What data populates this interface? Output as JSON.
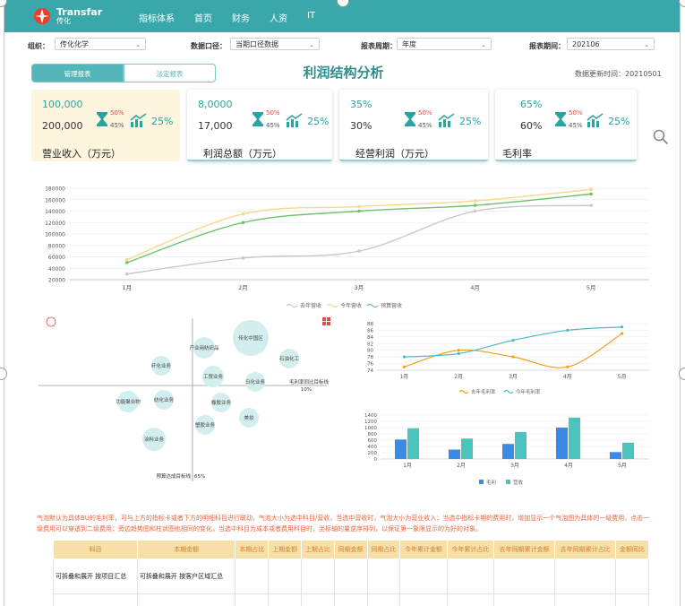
{
  "topbar": {
    "brand": "Transfar",
    "brand_cn": "传化",
    "nav": [
      "指标体系",
      "首页",
      "财务",
      "人资",
      "IT"
    ]
  },
  "filters": [
    {
      "label": "组织：",
      "value": "传化化学"
    },
    {
      "label": "数据口径：",
      "value": "当期口径数据"
    },
    {
      "label": "报表周期：",
      "value": "年度"
    },
    {
      "label": "报表期间：",
      "value": "202106"
    }
  ],
  "tabs": {
    "active": "管理报表",
    "inactive": "法定报表"
  },
  "page_title": "利润结构分析",
  "update_time": "数据更新时间：20210501",
  "cards": [
    {
      "v1": "100,000",
      "v2": "200,000",
      "pct1": "50%",
      "pct2": "45%",
      "pct3": "25%",
      "name": "营业收入（万元）"
    },
    {
      "v1": "8,0000",
      "v2": "17,000",
      "pct1": "50%",
      "pct2": "45%",
      "pct3": "25%",
      "name": "利润总额（万元）"
    },
    {
      "v1": "35%",
      "v2": "30%",
      "pct1": "50%",
      "pct2": "45%",
      "pct3": "25%",
      "name": "经营利润（万元）"
    },
    {
      "v1": "65%",
      "v2": "60%",
      "pct1": "50%",
      "pct2": "45%",
      "pct3": "25%",
      "name": "毛利率"
    }
  ],
  "colors": {
    "teal": "#3aa8aa",
    "yellow": "#f5d98c",
    "green": "#6cc36a",
    "grey": "#c8c8c8",
    "orange": "#f0a020",
    "cyan": "#4fb8c6",
    "bar_blue": "#3b8be6",
    "bar_teal": "#4cc3bd"
  },
  "chart_data": [
    {
      "type": "line",
      "categories": [
        "1月",
        "2月",
        "3月",
        "4月",
        "5月"
      ],
      "ylim": [
        20000,
        180000
      ],
      "yticks": [
        20000,
        40000,
        60000,
        80000,
        100000,
        120000,
        140000,
        160000,
        180000
      ],
      "series": [
        {
          "name": "去年营收",
          "values": [
            30000,
            58000,
            70000,
            140000,
            150000
          ]
        },
        {
          "name": "今年营收",
          "values": [
            55000,
            135000,
            148000,
            158000,
            178000
          ]
        },
        {
          "name": "预算营收",
          "values": [
            50000,
            120000,
            140000,
            150000,
            170000
          ]
        }
      ]
    },
    {
      "type": "scatter",
      "bubbles": [
        "传化中国区",
        "产业用纺织品",
        "石油化工",
        "纤化业务",
        "工贸业务",
        "日化业务",
        "功能聚合物",
        "纺化业务",
        "橡胶业务",
        "塑胶业务",
        "美妆",
        "涂料业务"
      ],
      "xlabel": "毛利率同比目标线",
      "xlabel_value": "10%",
      "ylabel": "预算达成目标线",
      "ylabel_value": "65%"
    },
    {
      "type": "line",
      "categories": [
        "1月",
        "2月",
        "3月",
        "4月",
        "5月"
      ],
      "ylim": [
        74,
        88
      ],
      "yticks": [
        74,
        76,
        78,
        80,
        82,
        84,
        86,
        88
      ],
      "series": [
        {
          "name": "去年毛利率",
          "values": [
            75,
            80,
            78,
            75,
            85
          ]
        },
        {
          "name": "今年毛利率",
          "values": [
            78,
            79,
            83,
            86,
            87
          ]
        }
      ]
    },
    {
      "type": "bar",
      "categories": [
        "1月",
        "2月",
        "3月",
        "4月",
        "5月"
      ],
      "ylim": [
        0,
        1400
      ],
      "yticks": [
        0,
        200,
        400,
        600,
        800,
        1000,
        1200,
        1400
      ],
      "series": [
        {
          "name": "毛利",
          "values": [
            620,
            300,
            480,
            1000,
            220
          ]
        },
        {
          "name": "营收",
          "values": [
            980,
            650,
            860,
            1320,
            520
          ]
        }
      ]
    }
  ],
  "description": "气泡默认为具体BU的毛利率，可与上方的指标卡或者下方的明细科目进行联动，气泡大小为选中科目/营收，当选中营收时，气泡大小为营业收入；当选中指标卡期的费用时，增加显示一个气泡图为具体的一级费用，点击一级费用可以穿透到二级费用；旁边趋势图和柱状图也相同的变化，当选中科目为成本或者费用科目时，坐标轴的量逆序排列，以保证第一象限显示的为好的对象。",
  "table": {
    "headers": [
      "科目",
      "本期金额",
      "本期占比",
      "上期金额",
      "上期占比",
      "同期金额",
      "同期占比",
      "今年累计金额",
      "今年累计占比",
      "去年同期累计金额",
      "去年同期累计占比",
      "金额同比"
    ],
    "rows": [
      [
        "可拆叠和展开 按项目汇总",
        "可拆叠和展开 按客户区域汇总",
        "",
        "",
        "",
        "",
        "",
        "",
        "",
        "",
        "",
        ""
      ]
    ]
  }
}
